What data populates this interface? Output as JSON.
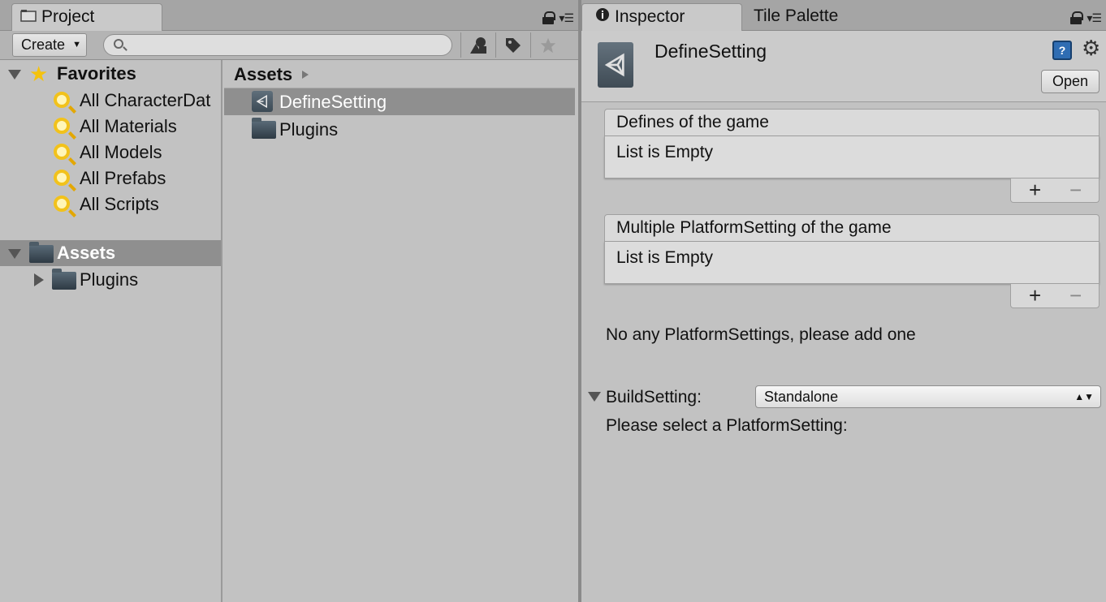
{
  "project": {
    "tab_label": "Project",
    "create_label": "Create",
    "search_placeholder": "",
    "favorites": {
      "label": "Favorites",
      "items": [
        "All CharacterDat",
        "All Materials",
        "All Models",
        "All Prefabs",
        "All Scripts"
      ]
    },
    "assets_root": "Assets",
    "asset_children": [
      "Plugins"
    ],
    "breadcrumb": "Assets",
    "files": [
      "DefineSetting",
      "Plugins"
    ]
  },
  "inspector": {
    "tabs": [
      "Inspector",
      "Tile Palette"
    ],
    "title": "DefineSetting",
    "open_label": "Open",
    "lists": [
      {
        "header": "Defines of the game",
        "empty_text": "List is Empty"
      },
      {
        "header": "Multiple PlatformSetting of the game",
        "empty_text": "List is Empty"
      }
    ],
    "plus_symbol": "+",
    "minus_symbol": "−",
    "no_settings_message": "No any PlatformSettings, please add one",
    "build_setting_label": "BuildSetting:",
    "build_setting_value": "Standalone",
    "select_prompt": "Please select a PlatformSetting:"
  },
  "icons": {
    "tab_project": "folder-icon",
    "tab_inspector": "info-icon",
    "favorites": "star-icon",
    "favorite_item": "search-filter-icon",
    "folder": "folder-icon",
    "asset": "unity-asset-icon",
    "help": "help-book-icon",
    "settings": "gear-icon"
  },
  "colors": {
    "panel_bg": "#c2c2c2",
    "tab_bar_bg": "#a5a5a5",
    "selection_bg": "#8f8f8f",
    "favorite_icon": "#f2c21b"
  }
}
